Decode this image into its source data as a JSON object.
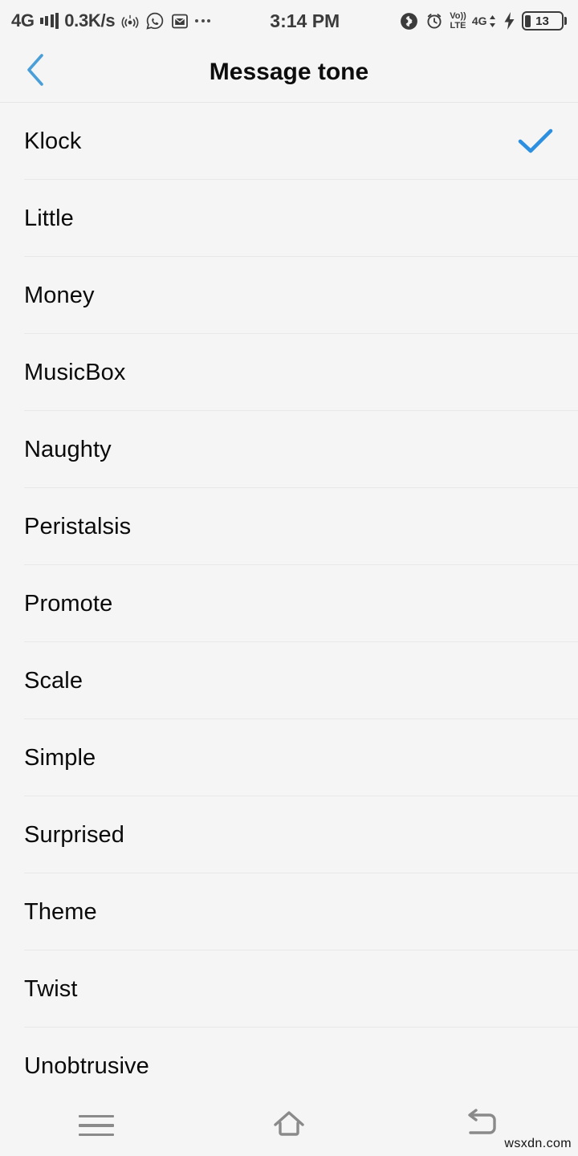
{
  "status_bar": {
    "network_label": "4G",
    "signal_icon": "signal-bars-icon",
    "data_speed": "0.3K/s",
    "hotspot_icon": "hotspot-icon",
    "whatsapp_icon": "whatsapp-icon",
    "mail_icon": "mail-icon",
    "more_icon": "more-dots-icon",
    "time": "3:14 PM",
    "bluetooth_icon": "bluetooth-icon",
    "alarm_icon": "alarm-clock-icon",
    "volte_line1": "Vo))",
    "volte_line2": "LTE",
    "data_network_label": "4G",
    "data_arrows": "data-transfer-arrows-icon",
    "charging_icon": "charging-bolt-icon",
    "battery_level": "13"
  },
  "header": {
    "back_icon": "back-chevron-icon",
    "title": "Message tone"
  },
  "list": {
    "selected": "Klock",
    "check_icon": "checkmark-icon",
    "accent_color": "#2d8fe0",
    "items": [
      {
        "label": "Klock",
        "selected": true
      },
      {
        "label": "Little",
        "selected": false
      },
      {
        "label": "Money",
        "selected": false
      },
      {
        "label": "MusicBox",
        "selected": false
      },
      {
        "label": "Naughty",
        "selected": false
      },
      {
        "label": "Peristalsis",
        "selected": false
      },
      {
        "label": "Promote",
        "selected": false
      },
      {
        "label": "Scale",
        "selected": false
      },
      {
        "label": "Simple",
        "selected": false
      },
      {
        "label": "Surprised",
        "selected": false
      },
      {
        "label": "Theme",
        "selected": false
      },
      {
        "label": "Twist",
        "selected": false
      },
      {
        "label": "Unobtrusive",
        "selected": false
      }
    ]
  },
  "nav_bar": {
    "menu_icon": "menu-icon",
    "home_icon": "home-icon",
    "back_icon": "back-arrow-icon"
  },
  "watermark": "wsxdn.com"
}
